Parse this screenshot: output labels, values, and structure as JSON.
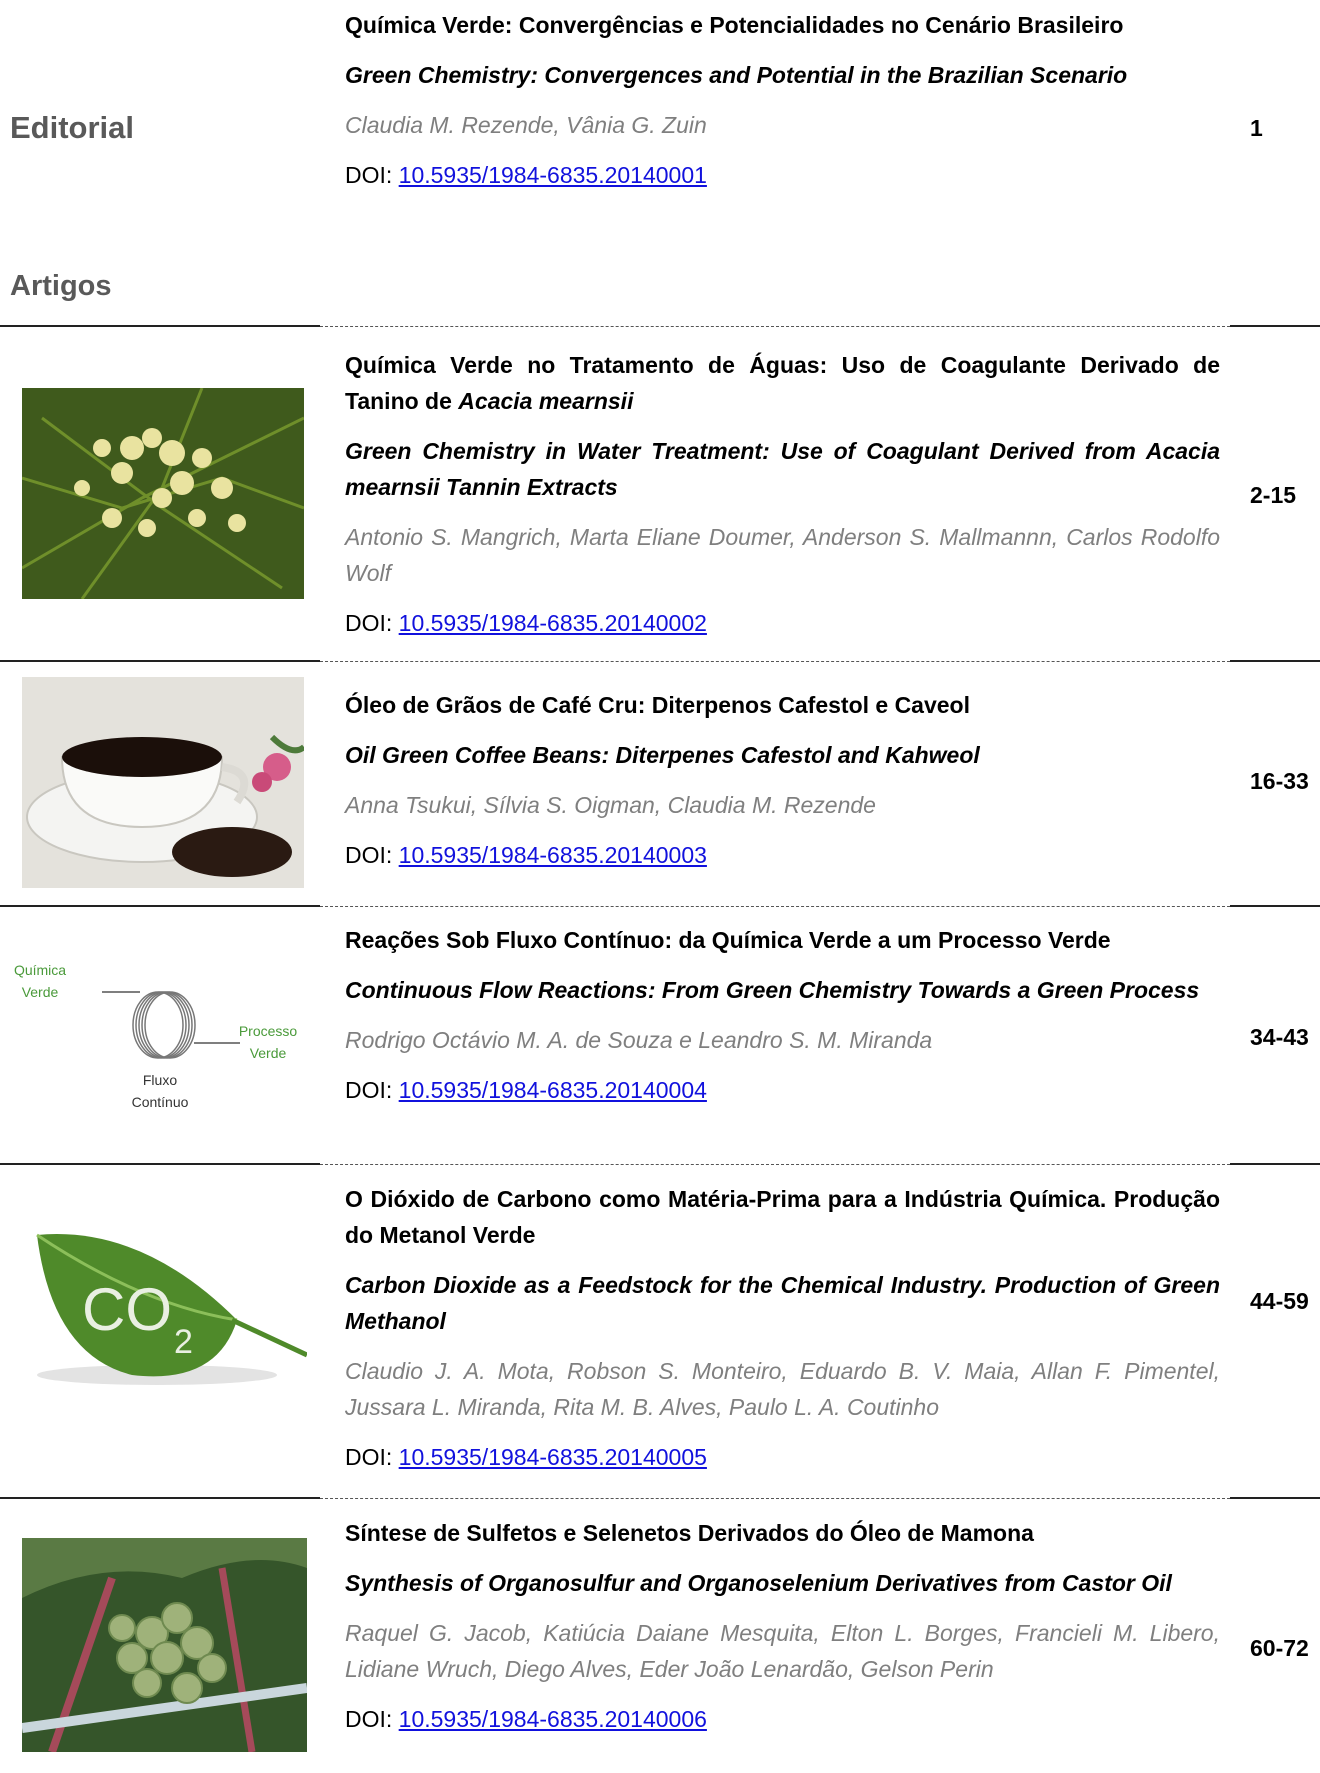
{
  "editorial": {
    "section": "Editorial",
    "title": "Química Verde: Convergências e Potencialidades no Cenário Brasileiro",
    "subtitle": "Green Chemistry: Convergences and Potential in the Brazilian Scenario",
    "authors": "Claudia M. Rezende, Vânia G. Zuin",
    "doi_prefix": "DOI: ",
    "doi": "10.5935/1984-6835.20140001",
    "pages": "1"
  },
  "articles_section": "Artigos",
  "articles": [
    {
      "title_main": "Química Verde no Tratamento de Águas: Uso de Coagulante Derivado de Tanino de ",
      "title_italic": "Acacia mearnsii",
      "subtitle": "Green Chemistry in Water Treatment: Use of Coagulant Derived from Acacia mearnsii Tannin Extracts",
      "authors": "Antonio S. Mangrich, Marta Eliane Doumer, Anderson S. Mallmannn, Carlos Rodolfo Wolf",
      "doi_prefix": "DOI: ",
      "doi": "10.5935/1984-6835.20140002",
      "pages": "2-15",
      "image_icon": "acacia-flower-photo"
    },
    {
      "title_main": "Óleo de Grãos de Café Cru: Diterpenos Cafestol e Caveol",
      "title_italic": "",
      "subtitle": "Oil Green Coffee Beans: Diterpenes Cafestol and Kahweol",
      "authors": "Anna Tsukui, Sílvia S. Oigman, Claudia M. Rezende",
      "doi_prefix": "DOI: ",
      "doi": "10.5935/1984-6835.20140003",
      "pages": "16-33",
      "image_icon": "coffee-cup-photo"
    },
    {
      "title_main": "Reações Sob Fluxo Contínuo: da Química Verde a um Processo Verde",
      "title_italic": "",
      "subtitle": "Continuous Flow Reactions: From Green Chemistry Towards a Green Process",
      "authors": "Rodrigo Octávio M. A. de Souza e Leandro S. M. Miranda",
      "doi_prefix": "DOI: ",
      "doi": "10.5935/1984-6835.20140004",
      "pages": "34-43",
      "image_icon": "flow-coil-diagram",
      "diagram": {
        "left_label_1": "Química",
        "left_label_2": "Verde",
        "right_label_1": "Processo",
        "right_label_2": "Verde",
        "bottom_label_1": "Fluxo",
        "bottom_label_2": "Contínuo"
      }
    },
    {
      "title_main": "O Dióxido de Carbono como Matéria-Prima para a Indústria Química. Produção do Metanol Verde",
      "title_italic": "",
      "subtitle": "Carbon Dioxide as a Feedstock for the Chemical Industry. Production of Green Methanol",
      "authors": "Claudio J. A. Mota, Robson S. Monteiro, Eduardo B. V. Maia, Allan F. Pimentel, Jussara L. Miranda, Rita M. B. Alves, Paulo L. A. Coutinho",
      "doi_prefix": "DOI: ",
      "doi": "10.5935/1984-6835.20140005",
      "pages": "44-59",
      "image_icon": "co2-leaf-photo",
      "image_text": "CO",
      "image_subscript": "2"
    },
    {
      "title_main": "Síntese de Sulfetos e Selenetos Derivados do Óleo de Mamona",
      "title_italic": "",
      "subtitle": "Synthesis of Organosulfur and Organoselenium Derivatives from Castor Oil",
      "authors": "Raquel G. Jacob, Katiúcia Daiane Mesquita, Elton L. Borges, Francieli M. Libero, Lidiane Wruch, Diego Alves, Eder João Lenardão, Gelson Perin",
      "doi_prefix": "DOI: ",
      "doi": "10.5935/1984-6835.20140006",
      "pages": "60-72",
      "image_icon": "castor-plant-photo"
    }
  ]
}
